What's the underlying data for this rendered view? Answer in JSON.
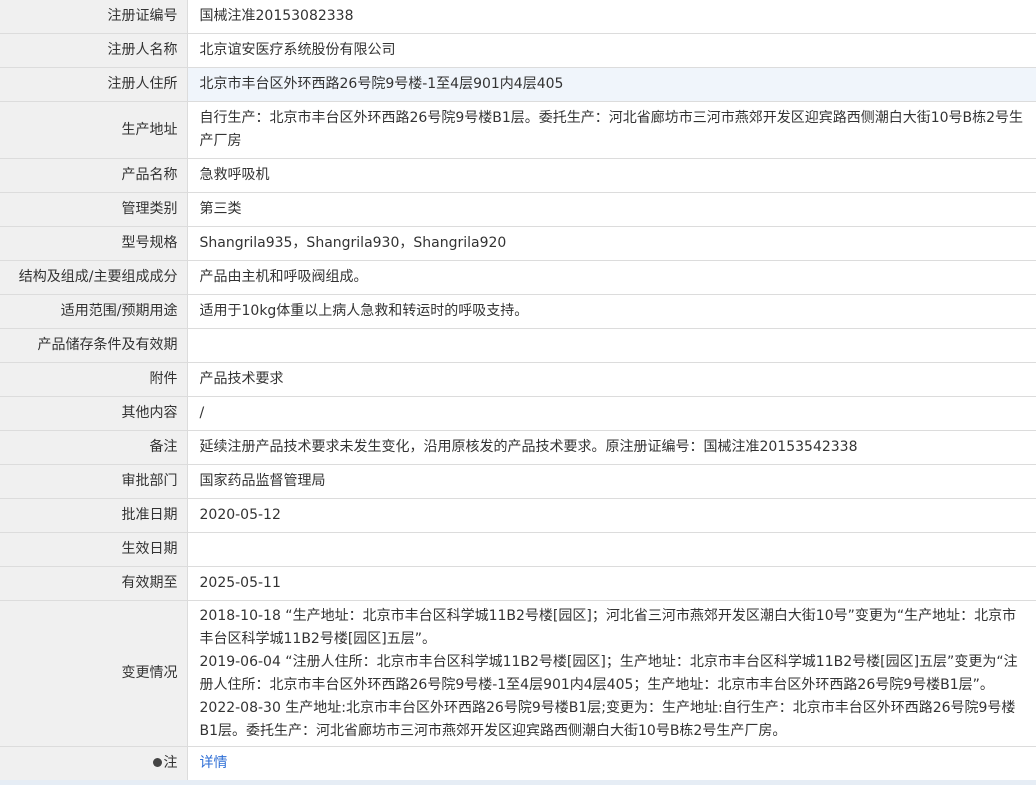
{
  "rows": [
    {
      "label": "注册证编号",
      "value": "国械注准20153082338"
    },
    {
      "label": "注册人名称",
      "value": "北京谊安医疗系统股份有限公司"
    },
    {
      "label": "注册人住所",
      "value": "北京市丰台区外环西路26号院9号楼-1至4层901内4层405"
    },
    {
      "label": "生产地址",
      "value": "自行生产：北京市丰台区外环西路26号院9号楼B1层。委托生产：河北省廊坊市三河市燕郊开发区迎宾路西侧潮白大街10号B栋2号生产厂房"
    },
    {
      "label": "产品名称",
      "value": "急救呼吸机"
    },
    {
      "label": "管理类别",
      "value": "第三类"
    },
    {
      "label": "型号规格",
      "value": "Shangrila935，Shangrila930，Shangrila920"
    },
    {
      "label": "结构及组成/主要组成成分",
      "value": "产品由主机和呼吸阀组成。"
    },
    {
      "label": "适用范围/预期用途",
      "value": "适用于10kg体重以上病人急救和转运时的呼吸支持。"
    },
    {
      "label": "产品储存条件及有效期",
      "value": ""
    },
    {
      "label": "附件",
      "value": "产品技术要求"
    },
    {
      "label": "其他内容",
      "value": "/"
    },
    {
      "label": "备注",
      "value": "延续注册产品技术要求未发生变化，沿用原核发的产品技术要求。原注册证编号：国械注准20153542338"
    },
    {
      "label": "审批部门",
      "value": "国家药品监督管理局"
    },
    {
      "label": "批准日期",
      "value": "2020-05-12"
    },
    {
      "label": "生效日期",
      "value": ""
    },
    {
      "label": "有效期至",
      "value": "2025-05-11"
    }
  ],
  "changes": {
    "label": "变更情况",
    "entries": [
      "2018-10-18 “生产地址：北京市丰台区科学城11B2号楼[园区]；河北省三河市燕郊开发区潮白大街10号”变更为“生产地址：北京市丰台区科学城11B2号楼[园区]五层”。",
      "2019-06-04 “注册人住所：北京市丰台区科学城11B2号楼[园区]；生产地址：北京市丰台区科学城11B2号楼[园区]五层”变更为“注册人住所：北京市丰台区外环西路26号院9号楼-1至4层901内4层405；生产地址：北京市丰台区外环西路26号院9号楼B1层”。",
      "2022-08-30 生产地址:北京市丰台区外环西路26号院9号楼B1层;变更为：生产地址:自行生产：北京市丰台区外环西路26号院9号楼B1层。委托生产：河北省廊坊市三河市燕郊开发区迎宾路西侧潮白大街10号B栋2号生产厂房。"
    ]
  },
  "note": {
    "label": "注",
    "icon": "pin-icon",
    "link_text": "详情"
  }
}
